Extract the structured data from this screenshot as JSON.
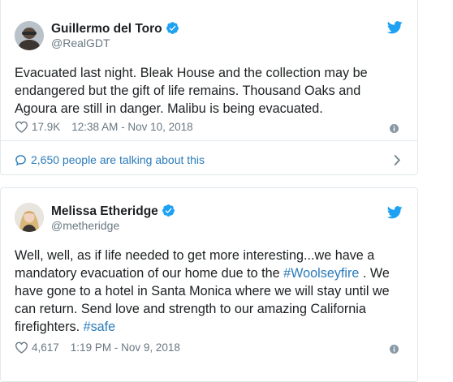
{
  "colors": {
    "link": "#2b7bb9",
    "meta": "#697882",
    "verified": "#1da1f2",
    "twitter": "#1da1f2",
    "border": "#e1e8ed"
  },
  "tweets": [
    {
      "name": "Guillermo del Toro",
      "handle": "@RealGDT",
      "text": "Evacuated last night. Bleak House and the collection may be endangered but the gift of life remains.  Thousand Oaks and Agoura are still in danger.  Malibu is being evacuated.",
      "likes": "17.9K",
      "timestamp": "12:38 AM - Nov 10, 2018",
      "talking": "2,650 people are talking about this"
    },
    {
      "name": "Melissa Etheridge",
      "handle": "@metheridge",
      "text_parts": [
        "Well, well, as if life needed to get more interesting...we have a mandatory evacuation of our home due to the ",
        "#Woolseyfire",
        " . We have gone to a hotel in Santa Monica where we will stay until we can return. Send love and strength to our amazing California firefighters. ",
        "#safe"
      ],
      "likes": "4,617",
      "timestamp": "1:19 PM - Nov 9, 2018"
    }
  ],
  "icons": [
    "verified-badge-icon",
    "twitter-bird-icon",
    "heart-icon",
    "info-icon",
    "speech-bubble-icon",
    "chevron-right-icon"
  ]
}
